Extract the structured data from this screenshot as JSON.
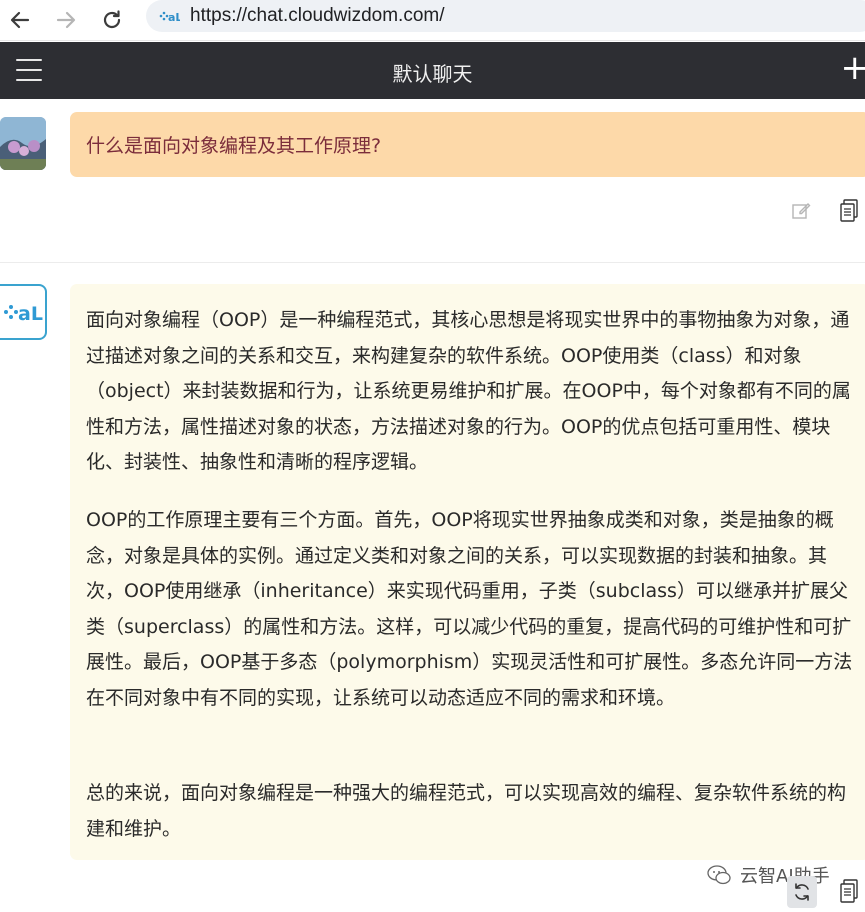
{
  "browser": {
    "url": "https://chat.cloudwizdom.com/",
    "back_icon": "arrow-left-icon",
    "forward_icon": "arrow-right-icon",
    "reload_icon": "reload-icon"
  },
  "header": {
    "title": "默认聊天",
    "menu_icon": "hamburger-menu-icon",
    "new_icon": "plus-icon"
  },
  "user_message": {
    "text": "什么是面向对象编程及其工作原理?",
    "bubble_color": "#fdd9a9",
    "text_color": "#7b2d3b",
    "actions": [
      "edit-icon",
      "copy-icon"
    ]
  },
  "ai_message": {
    "bubble_color": "#fdfaea",
    "paragraphs": [
      "面向对象编程（OOP）是一种编程范式，其核心思想是将现实世界中的事物抽象为对象，通过描述对象之间的关系和交互，来构建复杂的软件系统。OOP使用类（class）和对象（object）来封装数据和行为，让系统更易维护和扩展。在OOP中，每个对象都有不同的属性和方法，属性描述对象的状态，方法描述对象的行为。OOP的优点包括可重用性、模块化、封装性、抽象性和清晰的程序逻辑。",
      "OOP的工作原理主要有三个方面。首先，OOP将现实世界抽象成类和对象，类是抽象的概念，对象是具体的实例。通过定义类和对象之间的关系，可以实现数据的封装和抽象。其次，OOP使用继承（inheritance）来实现代码重用，子类（subclass）可以继承并扩展父类（superclass）的属性和方法。这样，可以减少代码的重复，提高代码的可维护性和可扩展性。最后，OOP基于多态（polymorphism）实现灵活性和可扩展性。多态允许同一方法在不同对象中有不同的实现，让系统可以动态适应不同的需求和环境。",
      "总的来说，面向对象编程是一种强大的编程范式，可以实现高效的编程、复杂软件系统的构建和维护。"
    ],
    "actions": [
      "regenerate-icon",
      "copy-icon"
    ]
  },
  "watermark": {
    "text": "云智AI助手"
  },
  "colors": {
    "header_bg": "#2d2e33",
    "accent": "#3aa3cf"
  }
}
